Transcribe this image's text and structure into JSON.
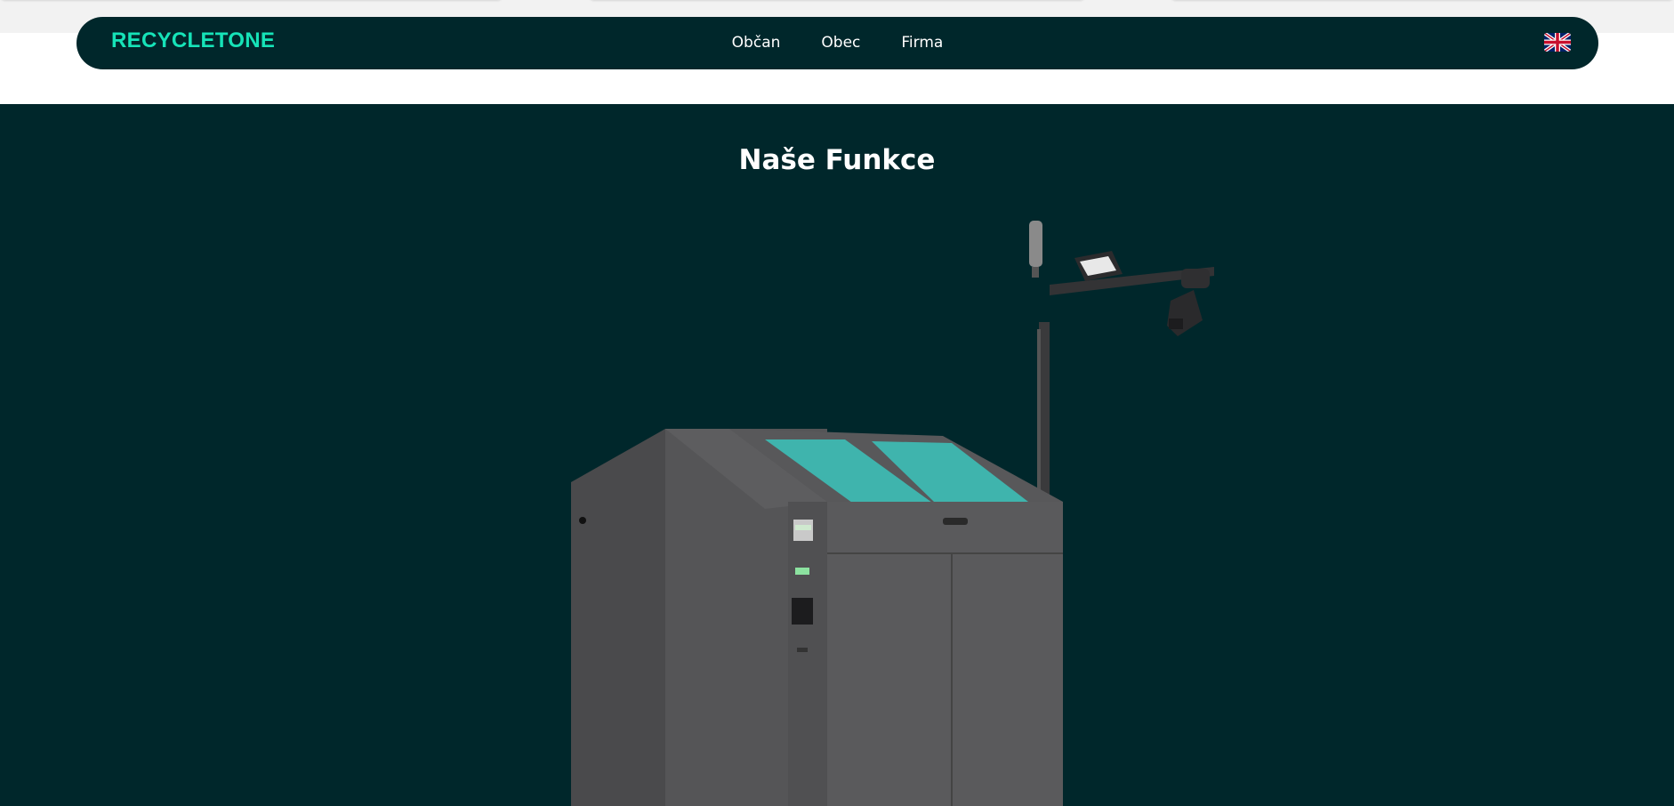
{
  "brand": {
    "logo_text": "RECYCLETONE",
    "logo_color": "#16e3b8"
  },
  "nav": {
    "items": [
      {
        "label": "Občan"
      },
      {
        "label": "Obec"
      },
      {
        "label": "Firma"
      }
    ],
    "language_icon": "uk-flag-icon"
  },
  "hero": {
    "title": "Naše Funkce",
    "background": "#00272b",
    "image": "recycling-machine-with-camera-pole-image"
  },
  "colors": {
    "navbar": "#00272b",
    "accent_teal": "#3fb4ad",
    "machine_gray": "#505052"
  }
}
